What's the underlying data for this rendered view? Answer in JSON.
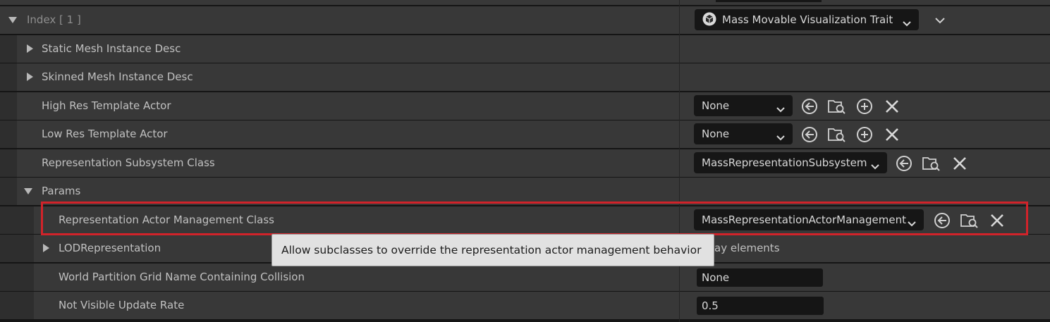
{
  "header_row": {
    "label": "Index [ 1 ]",
    "type_combo": "Mass Movable Visualization Trait",
    "type_icon": "cube-icon"
  },
  "rows": {
    "static_mesh": {
      "label": "Static Mesh Instance Desc"
    },
    "skinned_mesh": {
      "label": "Skinned Mesh Instance Desc"
    },
    "high_res": {
      "label": "High Res Template Actor",
      "value": "None"
    },
    "low_res": {
      "label": "Low Res Template Actor",
      "value": "None"
    },
    "rep_subsystem": {
      "label": "Representation Subsystem Class",
      "value": "MassRepresentationSubsystem"
    },
    "params": {
      "label": "Params"
    },
    "rep_actor_mgmt": {
      "label": "Representation Actor Management Class",
      "value": "MassRepresentationActorManagement"
    },
    "lod_rep": {
      "label": "LODRepresentation",
      "value_partial": "ay elements"
    },
    "world_partition": {
      "label": "World Partition Grid Name Containing Collision",
      "value": "None"
    },
    "not_visible": {
      "label": "Not Visible Update Rate",
      "value": "0.5"
    }
  },
  "tooltip": {
    "text": "Allow subclasses to override the representation actor management behavior"
  },
  "icons": [
    "reset-arrow-icon",
    "browse-folder-icon",
    "add-circle-icon",
    "clear-x-icon",
    "chevron-down-icon"
  ],
  "colors": {
    "row_bg": "#383838",
    "field_bg": "#151515",
    "highlight": "#d1232a",
    "tooltip_bg": "#e1e1e1"
  }
}
